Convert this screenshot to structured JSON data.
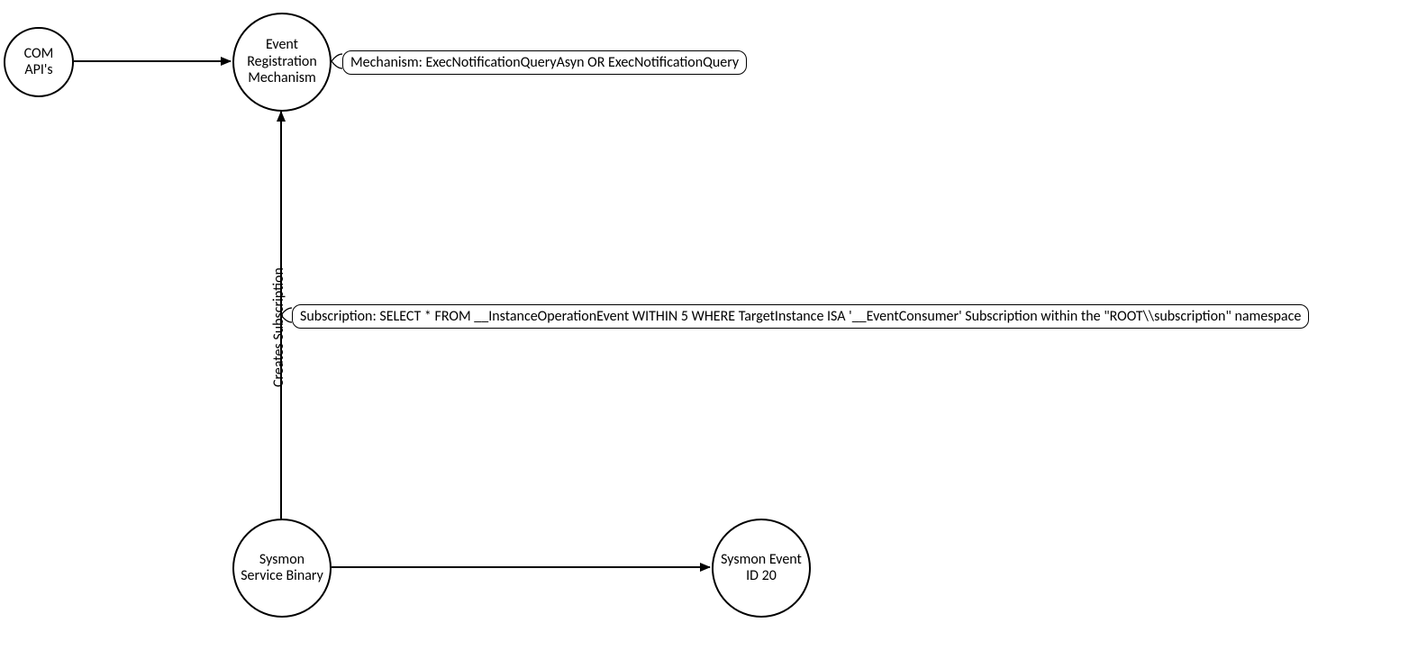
{
  "nodes": {
    "com_apis": "COM API's",
    "event_reg": "Event Registration Mechanism",
    "sysmon_binary": "Sysmon Service Binary",
    "sysmon_event": "Sysmon Event ID 20"
  },
  "annotations": {
    "mechanism": "Mechanism: ExecNotificationQueryAsyn OR ExecNotificationQuery",
    "subscription": "Subscription: SELECT * FROM __InstanceOperationEvent WITHIN 5 WHERE TargetInstance ISA '__EventConsumer' Subscription within the \"ROOT\\\\subscription\" namespace"
  },
  "edge_labels": {
    "creates_subscription": "Creates Subscription"
  }
}
